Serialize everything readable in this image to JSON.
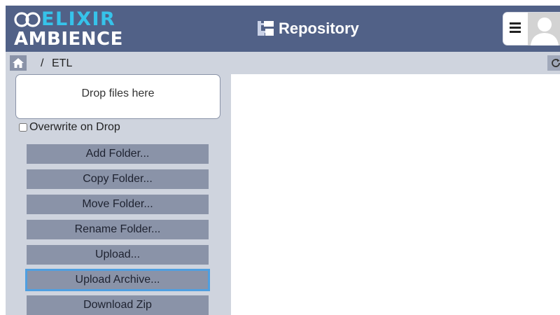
{
  "header": {
    "logo_top": "ELIXIR",
    "logo_bottom": "AMBIENCE",
    "title": "Repository",
    "icons": {
      "logo": "infinity-logo-icon",
      "repository": "folder-tree-icon",
      "menu": "hamburger-menu-icon",
      "avatar": "user-avatar-icon"
    }
  },
  "breadcrumb": {
    "separator": "/",
    "path": "ETL",
    "icons": {
      "home": "home-icon",
      "refresh": "refresh-icon"
    }
  },
  "sidebar": {
    "dropzone_text": "Drop files here",
    "overwrite_label": "Overwrite on Drop",
    "overwrite_checked": false,
    "actions": [
      {
        "label": "Add Folder..."
      },
      {
        "label": "Copy Folder..."
      },
      {
        "label": "Move Folder..."
      },
      {
        "label": "Rename Folder..."
      },
      {
        "label": "Upload..."
      },
      {
        "label": "Upload Archive..."
      },
      {
        "label": "Download Zip"
      }
    ]
  },
  "colors": {
    "header_bg": "#516187",
    "logo_accent": "#36c3ea",
    "panel_bg": "#cfd4de",
    "button_bg": "#8a93a8",
    "focus_ring": "#4f9fe0"
  }
}
